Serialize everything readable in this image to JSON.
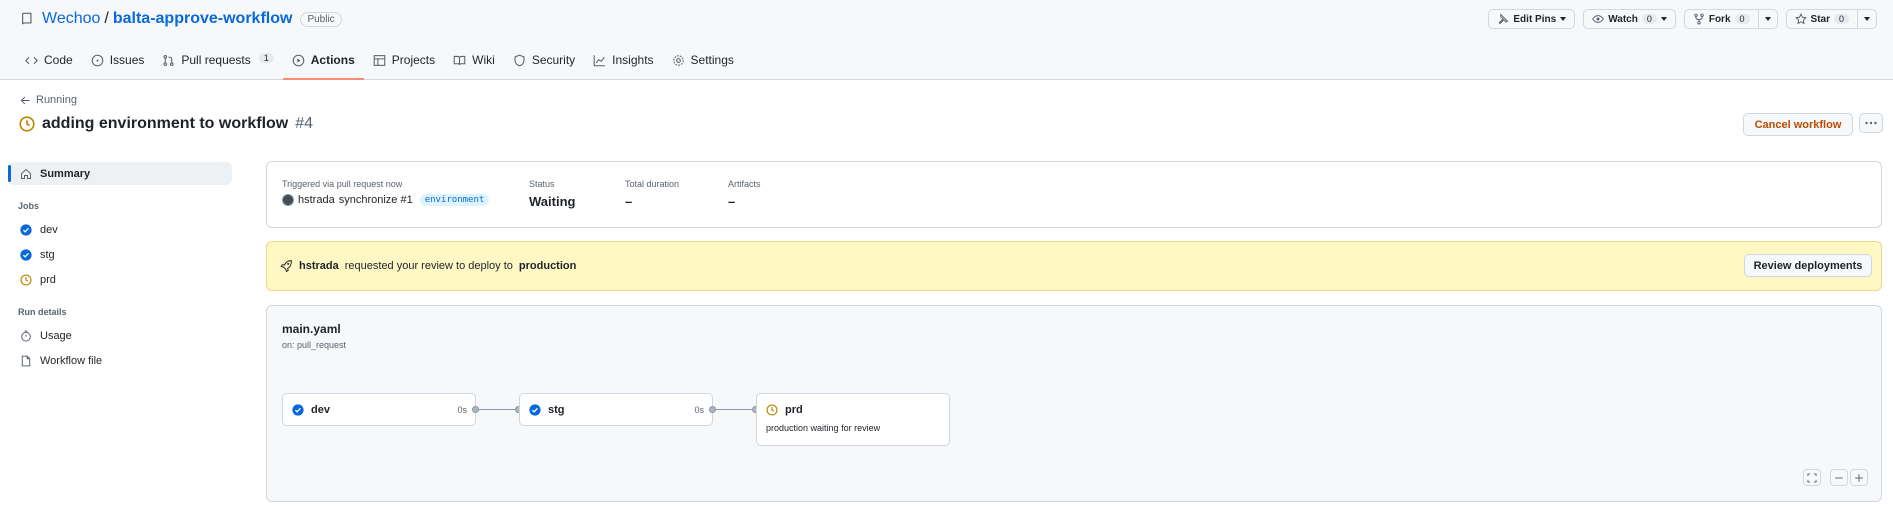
{
  "repo": {
    "owner": "Wechoo",
    "separator": "/",
    "name": "balta-approve-workflow",
    "visibility": "Public"
  },
  "header_actions": {
    "edit_pins": "Edit Pins",
    "watch": {
      "label": "Watch",
      "count": "0"
    },
    "fork": {
      "label": "Fork",
      "count": "0"
    },
    "star": {
      "label": "Star",
      "count": "0"
    }
  },
  "tabs": [
    {
      "label": "Code",
      "icon": "code-icon"
    },
    {
      "label": "Issues",
      "icon": "issue-icon"
    },
    {
      "label": "Pull requests",
      "icon": "pull-request-icon",
      "count": "1"
    },
    {
      "label": "Actions",
      "icon": "play-icon",
      "active": true
    },
    {
      "label": "Projects",
      "icon": "table-icon"
    },
    {
      "label": "Wiki",
      "icon": "book-icon"
    },
    {
      "label": "Security",
      "icon": "shield-icon"
    },
    {
      "label": "Insights",
      "icon": "graph-icon"
    },
    {
      "label": "Settings",
      "icon": "gear-icon"
    }
  ],
  "run": {
    "back_label": "Running",
    "title": "adding environment to workflow",
    "number": "#4",
    "cancel_label": "Cancel workflow"
  },
  "sidebar": {
    "summary": "Summary",
    "jobs_heading": "Jobs",
    "jobs": [
      {
        "label": "dev",
        "status": "success"
      },
      {
        "label": "stg",
        "status": "success"
      },
      {
        "label": "prd",
        "status": "waiting"
      }
    ],
    "details_heading": "Run details",
    "details": [
      {
        "label": "Usage",
        "icon": "stopwatch-icon"
      },
      {
        "label": "Workflow file",
        "icon": "file-icon"
      }
    ]
  },
  "summary": {
    "trigger_label": "Triggered via pull request now",
    "actor": "hstrada",
    "event": "synchronize #1",
    "branch_label": "environment",
    "status_label": "Status",
    "status_value": "Waiting",
    "duration_label": "Total duration",
    "duration_value": "–",
    "artifacts_label": "Artifacts",
    "artifacts_value": "–"
  },
  "review": {
    "actor": "hstrada",
    "text_mid": "requested your review to deploy to",
    "environment": "production",
    "button": "Review deployments"
  },
  "graph": {
    "file": "main.yaml",
    "trigger": "on: pull_request",
    "jobs": [
      {
        "name": "dev",
        "duration": "0s",
        "status": "success"
      },
      {
        "name": "stg",
        "duration": "0s",
        "status": "success"
      },
      {
        "name": "prd",
        "status": "waiting",
        "env": "production",
        "note": "waiting for review"
      }
    ]
  },
  "colors": {
    "accent": "#0969da",
    "success": "#0969da",
    "waiting": "#bf8700",
    "cancel": "#bc4c00",
    "review_bg": "#fff8c5"
  }
}
